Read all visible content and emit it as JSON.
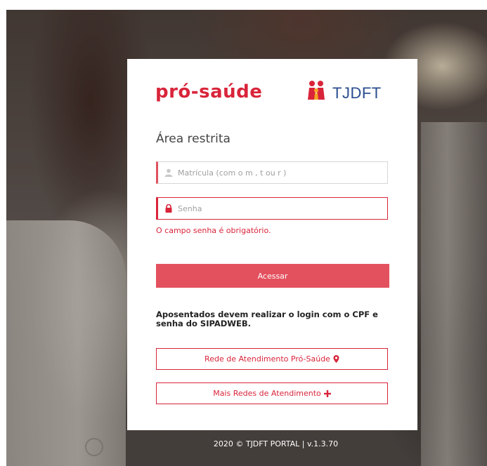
{
  "brand": {
    "name": "pró-saúde",
    "org": "TJDFT",
    "primary_color": "#d9243a",
    "org_color": "#2a4d8f",
    "icon": "family-icon"
  },
  "login": {
    "title": "Área restrita",
    "username_placeholder": "Matrícula (com o m , t ou r )",
    "username_icon": "user-icon",
    "password_placeholder": "Senha",
    "password_icon": "lock-icon",
    "password_error": "O campo senha é obrigatório.",
    "submit_label": "Acessar",
    "retiree_note": "Aposentados devem realizar o login com o CPF e senha do SIPADWEB."
  },
  "links": {
    "network_label": "Rede de Atendimento Pró-Saúde",
    "network_icon": "map-marker-icon",
    "more_networks_label": "Mais Redes de Atendimento",
    "more_networks_icon": "plus-icon"
  },
  "footer": {
    "text": "2020 © TJDFT PORTAL | v.1.3.70"
  }
}
